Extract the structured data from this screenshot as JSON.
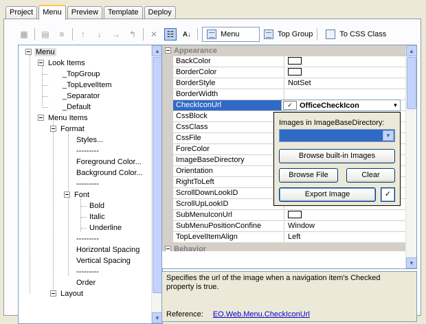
{
  "tabs": [
    {
      "label": "Project",
      "active": false
    },
    {
      "label": "Menu",
      "active": true
    },
    {
      "label": "Preview",
      "active": false
    },
    {
      "label": "Template",
      "active": false
    },
    {
      "label": "Deploy",
      "active": false
    }
  ],
  "toolbar": {
    "menu_button_label": "Menu",
    "top_group_label": "Top Group",
    "to_css_class_label": "To CSS Class"
  },
  "tree": {
    "root": "Menu",
    "look_items": "Look Items",
    "top_group": "_TopGroup",
    "top_level_item": "_TopLevelItem",
    "separator": "_Separator",
    "default": "_Default",
    "menu_items": "Menu Items",
    "format": "Format",
    "styles": "Styles...",
    "dashes1": "---------",
    "foreground_color": "Foreground Color...",
    "background_color": "Background Color...",
    "dashes2": "---------",
    "font": "Font",
    "bold": "Bold",
    "italic": "Italic",
    "underline": "Underline",
    "dashes3": "---------",
    "horizontal_spacing": "Horizontal Spacing",
    "vertical_spacing": "Vertical Spacing",
    "dashes4": "---------",
    "order": "Order",
    "layout": "Layout"
  },
  "properties": {
    "category_appearance": "Appearance",
    "category_behavior": "Behavior",
    "rows": [
      {
        "name": "BackColor",
        "value": ""
      },
      {
        "name": "BorderColor",
        "value": ""
      },
      {
        "name": "BorderStyle",
        "value": "NotSet"
      },
      {
        "name": "BorderWidth",
        "value": ""
      },
      {
        "name": "CheckIconUrl",
        "value": ""
      },
      {
        "name": "CssBlock",
        "value": ""
      },
      {
        "name": "CssClass",
        "value": ""
      },
      {
        "name": "CssFile",
        "value": ""
      },
      {
        "name": "ForeColor",
        "value": ""
      },
      {
        "name": "ImageBaseDirectory",
        "value": ""
      },
      {
        "name": "Orientation",
        "value": ""
      },
      {
        "name": "RightToLeft",
        "value": ""
      },
      {
        "name": "ScrollDownLookID",
        "value": ""
      },
      {
        "name": "ScrollUpLookID",
        "value": ""
      },
      {
        "name": "SubMenuIconUrl",
        "value": ""
      },
      {
        "name": "SubMenuPositionConfine",
        "value": "Window"
      },
      {
        "name": "TopLevelItemAlign",
        "value": "Left"
      }
    ]
  },
  "editor": {
    "value": "OfficeCheckIcon",
    "images_label": "Images in ImageBaseDirectory:",
    "browse_builtin": "Browse built-in Images",
    "browse_file": "Browse File",
    "clear": "Clear",
    "export_image": "Export Image"
  },
  "description": {
    "text": "Specifies the url of the image when a navigation item's Checked property is true.",
    "reference_label": "Reference:",
    "reference_link": "EO.Web.Menu.CheckIconUrl"
  }
}
